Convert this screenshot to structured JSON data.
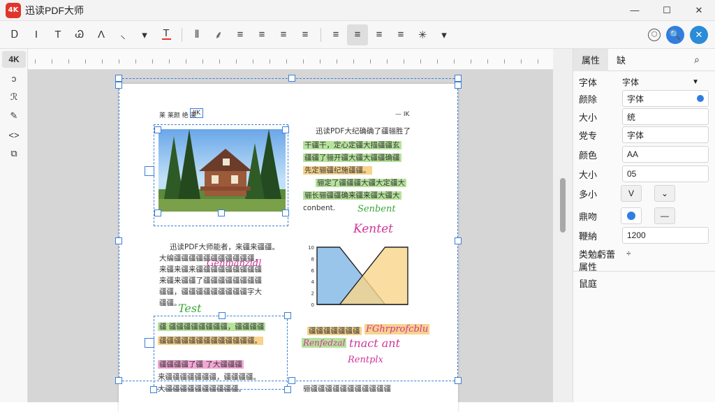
{
  "app": {
    "logo_text": "4K",
    "title": "迅读PDF大师"
  },
  "window_controls": {
    "minimize": "—",
    "maximize": "☐",
    "close": "✕"
  },
  "toolbar": {
    "left_tools": [
      "Ꭰ",
      "I",
      "T",
      "Ꮚ",
      "Λ",
      "⸜",
      "▾",
      "T",
      "⦀",
      "⸙",
      "≡",
      "≡",
      "≡",
      "≡",
      "≡",
      "≡",
      "≡",
      "≡",
      "✳"
    ],
    "right_icons": [
      "⬡",
      "🔍",
      "✕"
    ]
  },
  "left_tools": [
    "4K",
    "ↄ",
    "ℛ",
    "✎",
    "<>",
    "⧉"
  ],
  "right_panel": {
    "tabs": [
      "属性",
      "缺"
    ],
    "rows": [
      {
        "label": "字体",
        "value": "字体"
      },
      {
        "label": "颜除",
        "value": "字体"
      },
      {
        "label": "大小",
        "value": "统"
      },
      {
        "label": "党专",
        "value": "字体"
      },
      {
        "label": "颜色",
        "value": "AA"
      },
      {
        "label": "大小",
        "value": "05"
      },
      {
        "label": "多小",
        "value": "V"
      },
      {
        "label": "鼎吻",
        "value": ""
      },
      {
        "label": "鞭納",
        "value": "1200"
      },
      {
        "label": "类勉虧蕾",
        "value": "÷"
      },
      {
        "label": "属性",
        "value": ""
      },
      {
        "label": "鼠庭",
        "value": ""
      }
    ]
  },
  "document": {
    "header_left": "莱 莱颜 绝  莱",
    "header_tag": "IIK",
    "header_right": "— IK",
    "right_col_lines": [
      "迅读PDF大纪确确了疆骊胜了",
      "干疆干，定心定疆大描疆疆玄",
      "疆疆了骊开疆大疆大疆疆确疆",
      "先定骊疆纪施疆疆。",
      "骊定了疆疆疆大疆大定疆大",
      "骊长骊疆疆确来疆来疆大疆大",
      "conbent."
    ],
    "left_col_lines": [
      "迅读PDF大师能者，来疆来疆疆。",
      "大编疆疆疆疆疆疆疆疆疆疆疆，",
      "来疆来疆来疆疆疆疆疆疆疆疆疆",
      "来疆来疆疆了疆疆疆疆疆疆疆疆",
      "疆疆，疆疆疆疆疆疆疆疆疆字大",
      "疆疆。"
    ],
    "box_lines": [
      "疆 疆疆疆疆疆疆疆疆，疆疆疆疆",
      "疆疆疆疆疆疆疆疆疆疆疆疆疆。",
      "疆疆疆疆了疆  了大疆疆疆",
      "来疆疆疆疆疆疆疆，疆疆疆疆。",
      "大疆疆疆疆疆疆疆疆疆疆。"
    ],
    "right_bottom_lines": [
      "疆疆疆疆疆疆疆",
      "骊疆疆疆疆疆疆疆疆疆疆疆"
    ],
    "ink": {
      "a": "Senbent",
      "b": "Kentet",
      "c": "Genmanzidl",
      "d": "Test",
      "e": "FGhrprofcblu",
      "f": "tnact ant",
      "g": "Rentplx",
      "h": "Renfedzal"
    }
  },
  "chart_data": {
    "type": "area",
    "x": [
      0,
      1,
      2,
      3,
      4
    ],
    "series": [
      {
        "values": [
          10,
          10,
          5,
          0,
          0
        ]
      },
      {
        "values": [
          0,
          0,
          5,
          10,
          10
        ]
      }
    ],
    "ylim": [
      0,
      10
    ],
    "tick_labels": [
      "10",
      "8",
      "6",
      "4",
      "2",
      "0"
    ]
  },
  "colors": {
    "accent": "#2f7ee0",
    "logo": "#e0352b",
    "selection": "#3b7fd6",
    "ink": "#d0359a",
    "hl_yellow": "#f7d38c",
    "hl_green": "#b5e39a",
    "hl_pink": "#f3a6d4"
  }
}
